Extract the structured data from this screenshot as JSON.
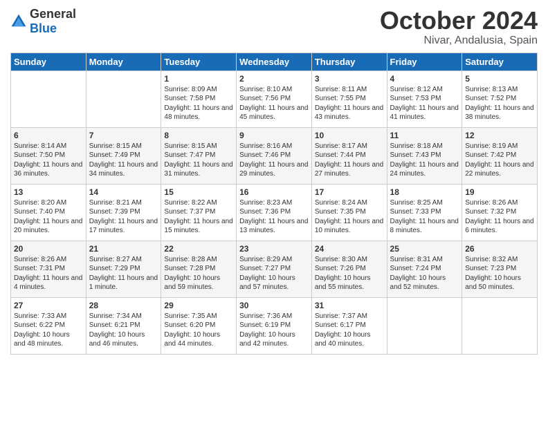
{
  "header": {
    "logo_general": "General",
    "logo_blue": "Blue",
    "month_title": "October 2024",
    "location": "Nivar, Andalusia, Spain"
  },
  "days_of_week": [
    "Sunday",
    "Monday",
    "Tuesday",
    "Wednesday",
    "Thursday",
    "Friday",
    "Saturday"
  ],
  "weeks": [
    [
      {
        "day": "",
        "detail": ""
      },
      {
        "day": "",
        "detail": ""
      },
      {
        "day": "1",
        "detail": "Sunrise: 8:09 AM\nSunset: 7:58 PM\nDaylight: 11 hours and 48 minutes."
      },
      {
        "day": "2",
        "detail": "Sunrise: 8:10 AM\nSunset: 7:56 PM\nDaylight: 11 hours and 45 minutes."
      },
      {
        "day": "3",
        "detail": "Sunrise: 8:11 AM\nSunset: 7:55 PM\nDaylight: 11 hours and 43 minutes."
      },
      {
        "day": "4",
        "detail": "Sunrise: 8:12 AM\nSunset: 7:53 PM\nDaylight: 11 hours and 41 minutes."
      },
      {
        "day": "5",
        "detail": "Sunrise: 8:13 AM\nSunset: 7:52 PM\nDaylight: 11 hours and 38 minutes."
      }
    ],
    [
      {
        "day": "6",
        "detail": "Sunrise: 8:14 AM\nSunset: 7:50 PM\nDaylight: 11 hours and 36 minutes."
      },
      {
        "day": "7",
        "detail": "Sunrise: 8:15 AM\nSunset: 7:49 PM\nDaylight: 11 hours and 34 minutes."
      },
      {
        "day": "8",
        "detail": "Sunrise: 8:15 AM\nSunset: 7:47 PM\nDaylight: 11 hours and 31 minutes."
      },
      {
        "day": "9",
        "detail": "Sunrise: 8:16 AM\nSunset: 7:46 PM\nDaylight: 11 hours and 29 minutes."
      },
      {
        "day": "10",
        "detail": "Sunrise: 8:17 AM\nSunset: 7:44 PM\nDaylight: 11 hours and 27 minutes."
      },
      {
        "day": "11",
        "detail": "Sunrise: 8:18 AM\nSunset: 7:43 PM\nDaylight: 11 hours and 24 minutes."
      },
      {
        "day": "12",
        "detail": "Sunrise: 8:19 AM\nSunset: 7:42 PM\nDaylight: 11 hours and 22 minutes."
      }
    ],
    [
      {
        "day": "13",
        "detail": "Sunrise: 8:20 AM\nSunset: 7:40 PM\nDaylight: 11 hours and 20 minutes."
      },
      {
        "day": "14",
        "detail": "Sunrise: 8:21 AM\nSunset: 7:39 PM\nDaylight: 11 hours and 17 minutes."
      },
      {
        "day": "15",
        "detail": "Sunrise: 8:22 AM\nSunset: 7:37 PM\nDaylight: 11 hours and 15 minutes."
      },
      {
        "day": "16",
        "detail": "Sunrise: 8:23 AM\nSunset: 7:36 PM\nDaylight: 11 hours and 13 minutes."
      },
      {
        "day": "17",
        "detail": "Sunrise: 8:24 AM\nSunset: 7:35 PM\nDaylight: 11 hours and 10 minutes."
      },
      {
        "day": "18",
        "detail": "Sunrise: 8:25 AM\nSunset: 7:33 PM\nDaylight: 11 hours and 8 minutes."
      },
      {
        "day": "19",
        "detail": "Sunrise: 8:26 AM\nSunset: 7:32 PM\nDaylight: 11 hours and 6 minutes."
      }
    ],
    [
      {
        "day": "20",
        "detail": "Sunrise: 8:26 AM\nSunset: 7:31 PM\nDaylight: 11 hours and 4 minutes."
      },
      {
        "day": "21",
        "detail": "Sunrise: 8:27 AM\nSunset: 7:29 PM\nDaylight: 11 hours and 1 minute."
      },
      {
        "day": "22",
        "detail": "Sunrise: 8:28 AM\nSunset: 7:28 PM\nDaylight: 10 hours and 59 minutes."
      },
      {
        "day": "23",
        "detail": "Sunrise: 8:29 AM\nSunset: 7:27 PM\nDaylight: 10 hours and 57 minutes."
      },
      {
        "day": "24",
        "detail": "Sunrise: 8:30 AM\nSunset: 7:26 PM\nDaylight: 10 hours and 55 minutes."
      },
      {
        "day": "25",
        "detail": "Sunrise: 8:31 AM\nSunset: 7:24 PM\nDaylight: 10 hours and 52 minutes."
      },
      {
        "day": "26",
        "detail": "Sunrise: 8:32 AM\nSunset: 7:23 PM\nDaylight: 10 hours and 50 minutes."
      }
    ],
    [
      {
        "day": "27",
        "detail": "Sunrise: 7:33 AM\nSunset: 6:22 PM\nDaylight: 10 hours and 48 minutes."
      },
      {
        "day": "28",
        "detail": "Sunrise: 7:34 AM\nSunset: 6:21 PM\nDaylight: 10 hours and 46 minutes."
      },
      {
        "day": "29",
        "detail": "Sunrise: 7:35 AM\nSunset: 6:20 PM\nDaylight: 10 hours and 44 minutes."
      },
      {
        "day": "30",
        "detail": "Sunrise: 7:36 AM\nSunset: 6:19 PM\nDaylight: 10 hours and 42 minutes."
      },
      {
        "day": "31",
        "detail": "Sunrise: 7:37 AM\nSunset: 6:17 PM\nDaylight: 10 hours and 40 minutes."
      },
      {
        "day": "",
        "detail": ""
      },
      {
        "day": "",
        "detail": ""
      }
    ]
  ]
}
